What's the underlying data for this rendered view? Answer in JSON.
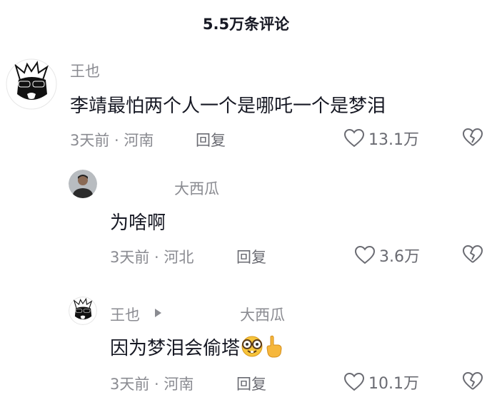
{
  "header": {
    "title": "5.5万条评论"
  },
  "comments": [
    {
      "username": "王也",
      "avatar": "sunglasses-cartoon-avatar",
      "text": "李靖最怕两个人一个是哪吒一个是梦泪",
      "meta": "3天前 · 河南",
      "reply_label": "回复",
      "likes": "13.1万"
    },
    {
      "username": "大西瓜",
      "avatar": "photo-avatar",
      "text": "为啥啊",
      "meta": "3天前 · 河北",
      "reply_label": "回复",
      "likes": "3.6万"
    },
    {
      "username": "王也",
      "reply_to": "大西瓜",
      "avatar": "sunglasses-cartoon-avatar",
      "text": "因为梦泪会偷塔",
      "emojis": [
        "nerd-face-emoji",
        "pointing-up-hand-emoji"
      ],
      "meta": "3天前 · 河南",
      "reply_label": "回复",
      "likes": "10.1万"
    }
  ],
  "icons": {
    "like": "heart-outline-icon",
    "dislike": "broken-heart-icon",
    "reply_arrow": "play-arrow-icon"
  },
  "colors": {
    "primary_text": "#161823",
    "secondary_text": "#8a8b91",
    "icon": "#6a6b72",
    "background": "#ffffff"
  }
}
